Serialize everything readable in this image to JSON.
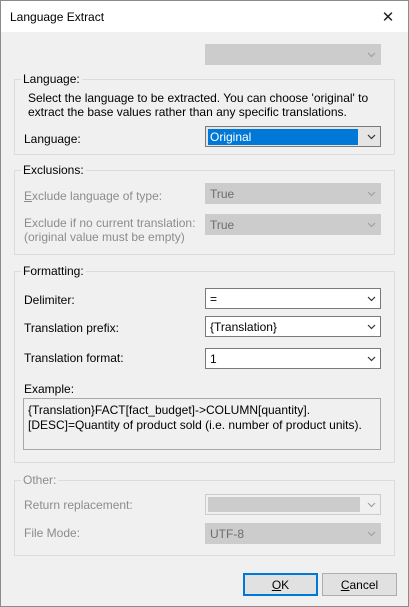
{
  "window": {
    "title": "Language Extract",
    "close_glyph": "✕"
  },
  "top_combo": {
    "value": ""
  },
  "language": {
    "group_label": "Language:",
    "description": "Select the language to be extracted.  You can choose 'original' to extract the base values rather than any specific translations.",
    "label": "Language:",
    "value": "Original"
  },
  "exclusions": {
    "group_label": "Exclusions:",
    "exclude_type_label_u": "E",
    "exclude_type_label_rest": "xclude language of type:",
    "exclude_type_value": "True",
    "exclude_no_translation_label": "Exclude if no current translation:",
    "exclude_no_translation_note": "(original value must be empty)",
    "exclude_no_translation_value": "True"
  },
  "formatting": {
    "group_label": "Formatting:",
    "delimiter_label": "Delimiter:",
    "delimiter_value": "=",
    "prefix_label": "Translation prefix:",
    "prefix_value": "{Translation}",
    "format_label": "Translation format:",
    "format_value": "1",
    "example_label": "Example:",
    "example_text": "{Translation}FACT[fact_budget]->COLUMN[quantity].[DESC]=Quantity of product sold (i.e. number of product units)."
  },
  "other": {
    "group_label": "Other:",
    "return_replacement_label": "Return replacement:",
    "return_replacement_value": "",
    "file_mode_label": "File Mode:",
    "file_mode_value": "UTF-8"
  },
  "buttons": {
    "ok_u": "O",
    "ok_rest": "K",
    "cancel_u": "C",
    "cancel_rest": "ancel"
  }
}
